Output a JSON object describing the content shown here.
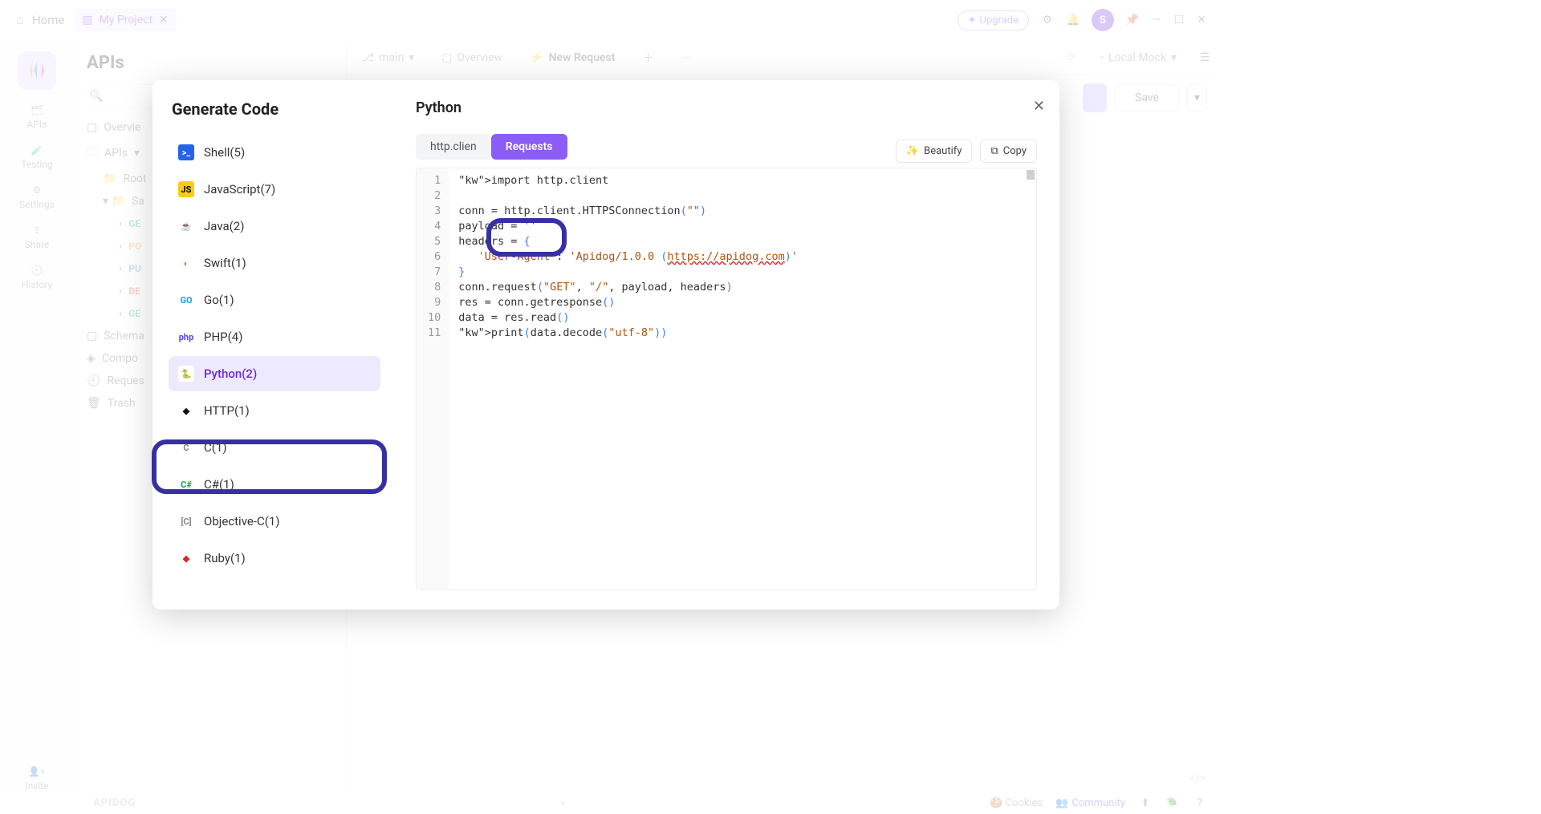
{
  "titlebar": {
    "home": "Home",
    "project_name": "My Project",
    "upgrade": "Upgrade",
    "avatar_initial": "S"
  },
  "leftnav": {
    "items": [
      "APIs",
      "Testing",
      "Settings",
      "Share",
      "History",
      "Invite"
    ]
  },
  "midcol": {
    "title": "APIs",
    "overview": "Overvie",
    "apis_label": "APIs",
    "root": "Root",
    "sample": "Sa",
    "methods": [
      {
        "m": "GET",
        "label": "GE",
        "cls": "m-get"
      },
      {
        "m": "POST",
        "label": "PO",
        "cls": "m-post"
      },
      {
        "m": "PUT",
        "label": "PU",
        "cls": "m-put"
      },
      {
        "m": "DEL",
        "label": "DE",
        "cls": "m-del"
      },
      {
        "m": "GET",
        "label": "GE",
        "cls": "m-get"
      }
    ],
    "schemas": "Schema",
    "components": "Compo",
    "request_h": "Reques",
    "trash": "Trash"
  },
  "tabs": {
    "branch": "main",
    "overview": "Overview",
    "new_request": "New Request"
  },
  "env": {
    "name": "Local Mock",
    "save": "Save"
  },
  "modal": {
    "title": "Generate Code",
    "right_title": "Python",
    "languages": [
      {
        "name": "Shell(5)",
        "bg": "#2563eb",
        "txt": ">_"
      },
      {
        "name": "JavaScript(7)",
        "bg": "#facc15",
        "txt": "JS",
        "fg": "#000"
      },
      {
        "name": "Java(2)",
        "bg": "#fff",
        "txt": "☕",
        "fg": "#b45309"
      },
      {
        "name": "Swift(1)",
        "bg": "#fff",
        "txt": "◐",
        "fg": "#f97316"
      },
      {
        "name": "Go(1)",
        "bg": "#fff",
        "txt": "GO",
        "fg": "#0ea5e9"
      },
      {
        "name": "PHP(4)",
        "bg": "#fff",
        "txt": "php",
        "fg": "#4f46e5"
      },
      {
        "name": "Python(2)",
        "bg": "#fff",
        "txt": "🐍"
      },
      {
        "name": "HTTP(1)",
        "bg": "#fff",
        "txt": "◆",
        "fg": "#111"
      },
      {
        "name": "C(1)",
        "bg": "#fff",
        "txt": "C",
        "fg": "#888"
      },
      {
        "name": "C#(1)",
        "bg": "#fff",
        "txt": "C#",
        "fg": "#16a34a"
      },
      {
        "name": "Objective-C(1)",
        "bg": "#fff",
        "txt": "[C]",
        "fg": "#888"
      },
      {
        "name": "Ruby(1)",
        "bg": "#fff",
        "txt": "◆",
        "fg": "#dc2626"
      }
    ],
    "selected_lang_index": 6,
    "lib_tabs": [
      "http.clien",
      "Requests"
    ],
    "active_lib_index": 1,
    "beautify": "Beautify",
    "copy": "Copy",
    "code_lines": [
      "import http.client",
      "",
      "conn = http.client.HTTPSConnection(\"\")",
      "payload = ''",
      "headers = {",
      "   'User-Agent': 'Apidog/1.0.0 (https://apidog.com)'",
      "}",
      "conn.request(\"GET\", \"/\", payload, headers)",
      "res = conn.getresponse()",
      "data = res.read()",
      "print(data.decode(\"utf-8\"))"
    ]
  },
  "bottom": {
    "cookies": "Cookies",
    "community": "Community",
    "logo": "APIDOG"
  }
}
